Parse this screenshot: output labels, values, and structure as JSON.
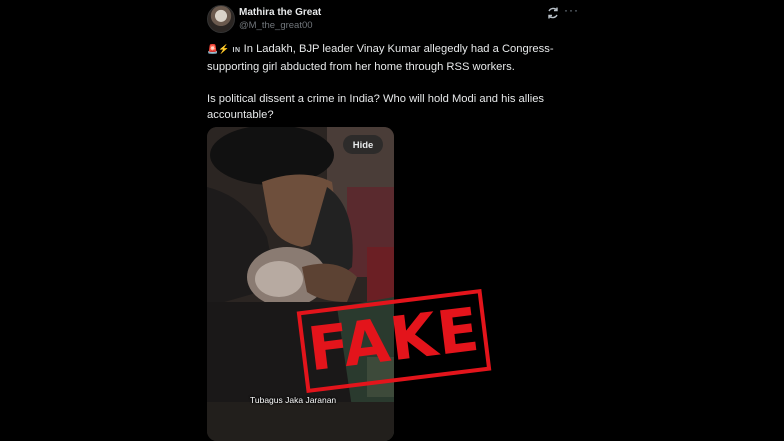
{
  "author": {
    "display_name": "Mathira the Great",
    "handle": "@M_the_great00"
  },
  "header": {
    "grok_icon": "grok-refresh-icon",
    "more_icon": "more-dots-icon",
    "more_glyph": "···"
  },
  "tweet": {
    "emoji_prefix": "🚨⚡",
    "in_badge": "IN",
    "paragraph_1": "In Ladakh, BJP leader Vinay Kumar allegedly had a Congress-supporting girl abducted from her home through RSS workers.",
    "paragraph_2": "Is political dissent a crime in India? Who will hold Modi and his allies accountable?"
  },
  "media": {
    "hide_label": "Hide",
    "video_caption": "Tubagus Jaka Jaranan"
  },
  "stamp": {
    "label": "FAKE",
    "color": "#e3141b"
  }
}
